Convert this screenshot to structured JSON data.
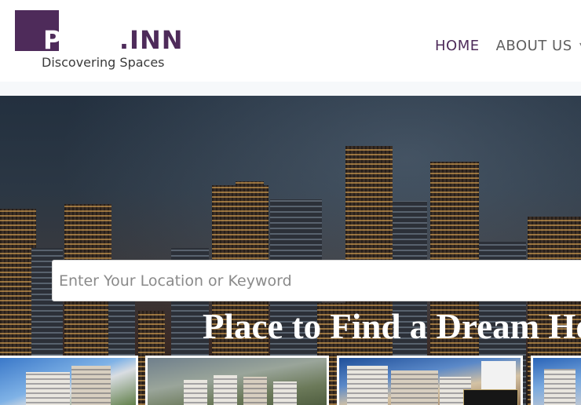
{
  "brand": {
    "logo_prefix": "PROP",
    "logo_suffix": ".INN",
    "tagline": "Discovering Spaces",
    "color": "#4e2b5a"
  },
  "nav": {
    "items": [
      {
        "label": "HOME",
        "active": true
      },
      {
        "label": "ABOUT US",
        "active": false
      }
    ]
  },
  "hero": {
    "title": "Place to Find a Dream Home",
    "search_placeholder": "Enter Your Location or Keyword"
  },
  "properties": {
    "card_count": 4
  }
}
